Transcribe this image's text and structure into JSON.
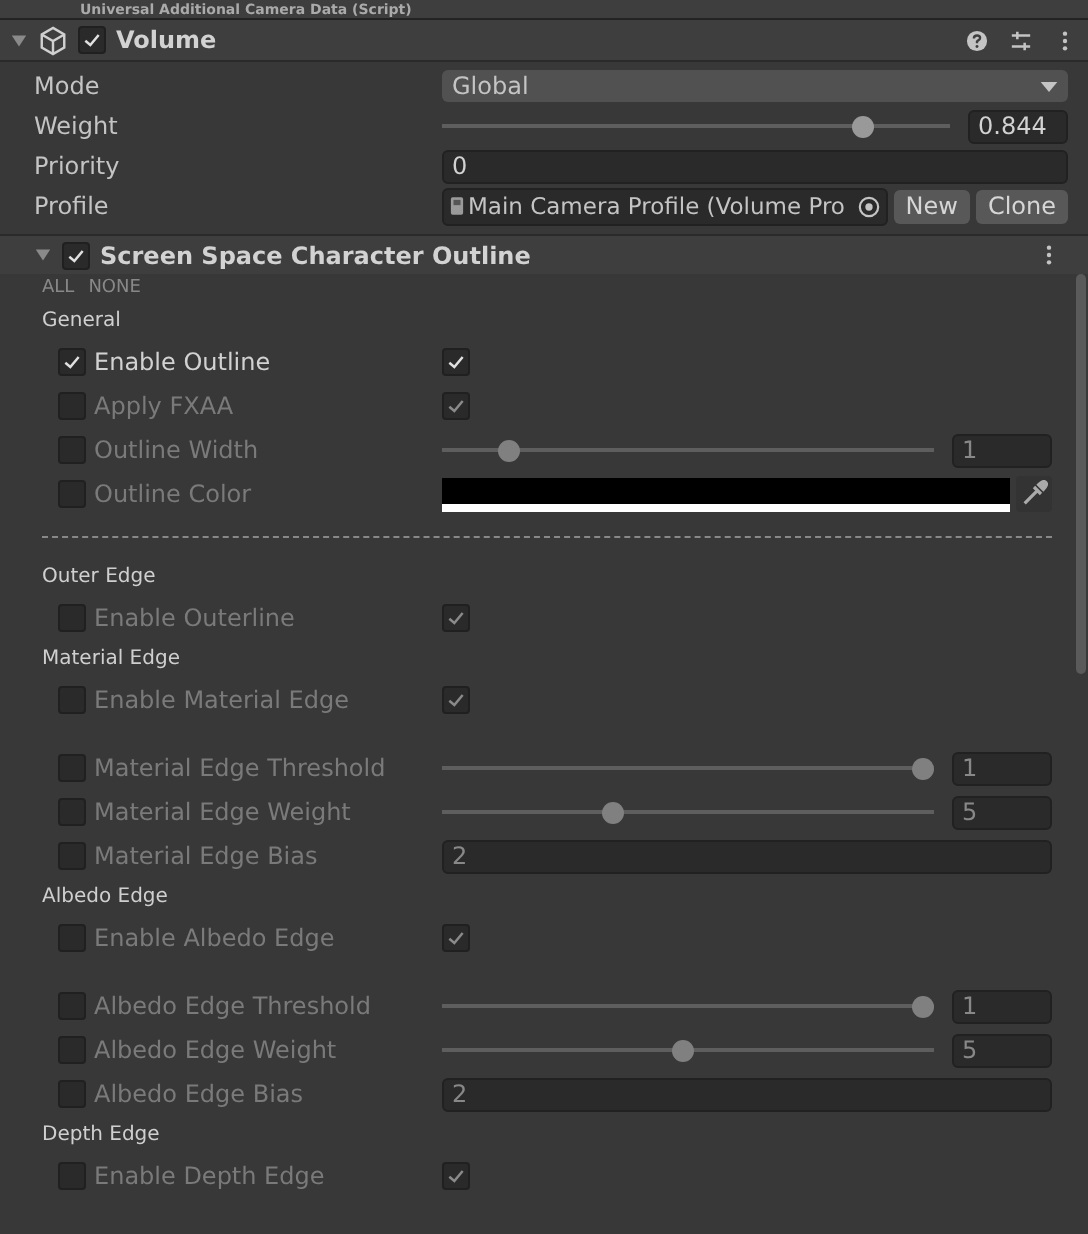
{
  "previous_component": {
    "title": "Universal Additional Camera Data (Script)"
  },
  "component": {
    "title": "Volume",
    "enabled": true,
    "expanded": true
  },
  "fields": [
    {
      "kind": "dropdown",
      "label": "Mode",
      "value": "Global"
    },
    {
      "kind": "slider",
      "label": "Weight",
      "level": 0.844,
      "value": "0.844"
    },
    {
      "kind": "number",
      "label": "Priority",
      "value": "0"
    },
    {
      "kind": "object",
      "label": "Profile",
      "value": "Main Camera Profile (Volume Pro",
      "buttons": [
        "New",
        "Clone"
      ]
    }
  ],
  "override": {
    "title": "Screen Space Character Outline",
    "enabled": true,
    "expanded": true,
    "all": "ALL",
    "none": "NONE",
    "items": [
      {
        "kind": "header",
        "label": "General"
      },
      {
        "kind": "toggle",
        "label": "Enable Outline",
        "overridden": true,
        "checked": true
      },
      {
        "kind": "toggle",
        "label": "Apply FXAA",
        "overridden": false,
        "checked": true
      },
      {
        "kind": "slider",
        "label": "Outline Width",
        "overridden": false,
        "level": 0.12,
        "value": "1"
      },
      {
        "kind": "color",
        "label": "Outline Color",
        "overridden": false,
        "color": "#000000"
      },
      {
        "kind": "separator"
      },
      {
        "kind": "header",
        "label": "Outer Edge"
      },
      {
        "kind": "toggle",
        "label": "Enable Outerline",
        "overridden": false,
        "checked": true
      },
      {
        "kind": "header",
        "label": "Material Edge"
      },
      {
        "kind": "toggle",
        "label": "Enable Material Edge",
        "overridden": false,
        "checked": true
      },
      {
        "kind": "gap"
      },
      {
        "kind": "slider",
        "label": "Material Edge Threshold",
        "overridden": false,
        "level": 1,
        "value": "1"
      },
      {
        "kind": "slider",
        "label": "Material Edge Weight",
        "overridden": false,
        "level": 0.34,
        "value": "5"
      },
      {
        "kind": "number",
        "label": "Material Edge Bias",
        "overridden": false,
        "value": "2"
      },
      {
        "kind": "header",
        "label": "Albedo Edge"
      },
      {
        "kind": "toggle",
        "label": "Enable Albedo Edge",
        "overridden": false,
        "checked": true
      },
      {
        "kind": "gap"
      },
      {
        "kind": "slider",
        "label": "Albedo Edge Threshold",
        "overridden": false,
        "level": 1,
        "value": "1"
      },
      {
        "kind": "slider",
        "label": "Albedo Edge Weight",
        "overridden": false,
        "level": 0.49,
        "value": "5"
      },
      {
        "kind": "number",
        "label": "Albedo Edge Bias",
        "overridden": false,
        "value": "2"
      },
      {
        "kind": "header",
        "label": "Depth Edge"
      },
      {
        "kind": "toggle",
        "label": "Enable Depth Edge",
        "overridden": false,
        "checked": true
      }
    ]
  }
}
